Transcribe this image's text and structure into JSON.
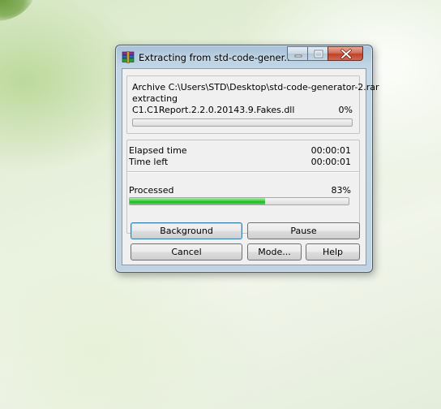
{
  "window": {
    "title": "Extracting from std-code-gener...",
    "icon": "winrar-books-icon"
  },
  "archive": {
    "path_line": "Archive C:\\Users\\STD\\Desktop\\std-code-generator-2.rar",
    "action": "extracting",
    "current_file": "C1.C1Report.2.2.0.20143.9.Fakes.dll",
    "file_percent_text": "0%",
    "file_progress": 0
  },
  "timing": {
    "elapsed_label": "Elapsed time",
    "elapsed_value": "00:00:01",
    "left_label": "Time left",
    "left_value": "00:00:01"
  },
  "processed": {
    "label": "Processed",
    "percent_text": "83%",
    "progress": 0.62
  },
  "buttons": {
    "background": "Background",
    "pause": "Pause",
    "cancel": "Cancel",
    "mode": "Mode...",
    "help": "Help"
  },
  "colors": {
    "progress_green": "#2fc42f",
    "default_button_border": "#3c7fb1",
    "close_button": "#c0402a"
  }
}
